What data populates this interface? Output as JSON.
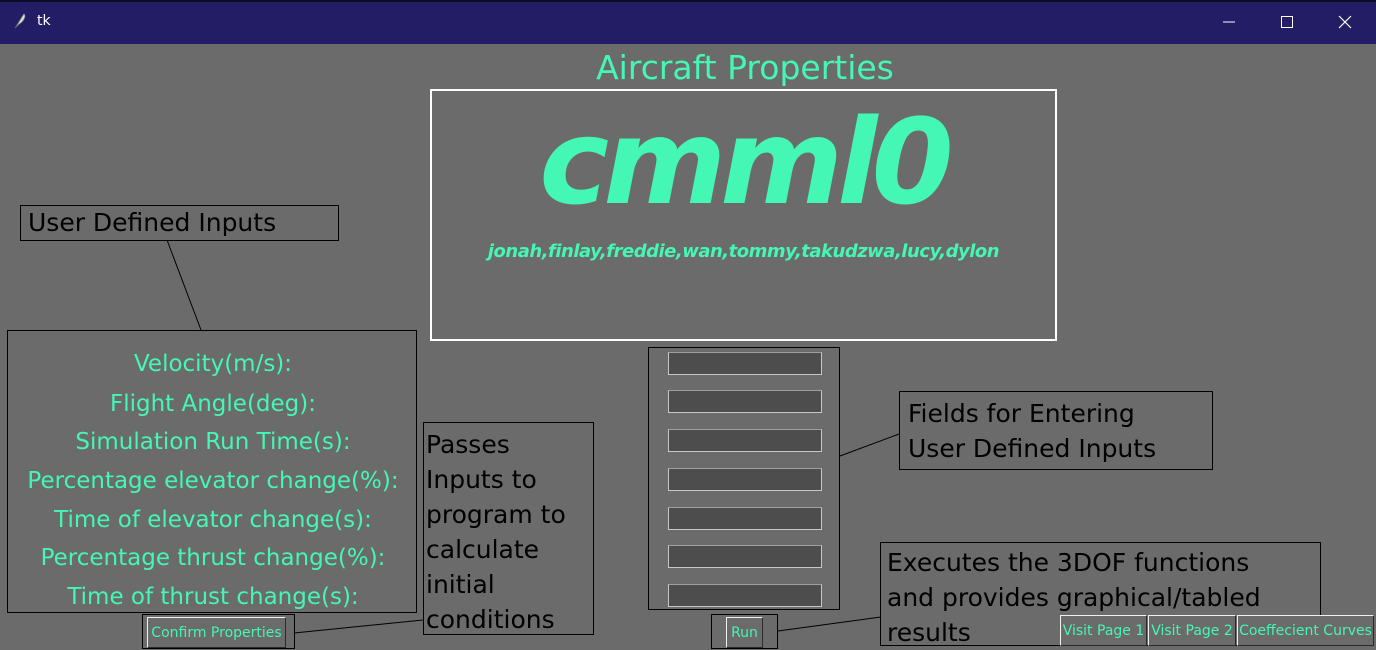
{
  "window": {
    "title": "tk",
    "controls": [
      "minimize",
      "maximize",
      "close"
    ]
  },
  "heading": "Aircraft Properties",
  "logo": {
    "text": "cmml0",
    "names": "jonah,finlay,freddie,wan,tommy,takudzwa,lucy,dylon"
  },
  "annotations": {
    "user_defined_inputs": "User Defined Inputs",
    "passes_inputs": [
      "Passes",
      "Inputs to",
      "program to",
      "calculate",
      "initial",
      "conditions"
    ],
    "fields_for_entering": [
      "Fields for Entering",
      "User Defined Inputs"
    ],
    "executes": [
      "Executes the 3DOF functions",
      "and provides graphical/tabled",
      "results"
    ]
  },
  "input_labels": [
    "Velocity(m/s):",
    "Flight Angle(deg):",
    "Simulation Run Time(s):",
    "Percentage elevator change(%):",
    "Time of elevator change(s):",
    "Percentage thrust change(%):",
    "Time of thrust change(s):"
  ],
  "input_values": [
    "",
    "",
    "",
    "",
    "",
    "",
    ""
  ],
  "buttons": {
    "confirm": "Confirm Properties",
    "run": "Run",
    "visit_page_1": "Visit Page 1",
    "visit_page_2": "Visit Page 2",
    "coefficient_curves": "Coeffecient Curves"
  },
  "colors": {
    "background": "#6b6b6b",
    "accent": "#44f7b4",
    "titlebar": "#221d65",
    "entry_bg": "#4d4d4d"
  }
}
